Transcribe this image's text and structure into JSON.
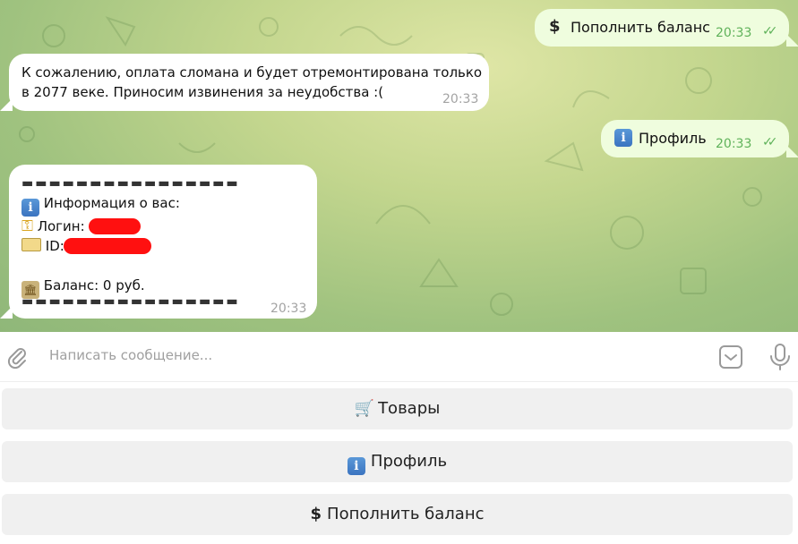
{
  "messages": {
    "topup_request": {
      "text": "Пополнить баланс",
      "time": "20:33"
    },
    "payment_error": {
      "line1": "К сожалению, оплата сломана и будет отремонтирована только",
      "line2": "в 2077 веке. Приносим извинения за неудобства :(",
      "time": "20:33"
    },
    "profile_request": {
      "text": "Профиль",
      "time": "20:33"
    },
    "profile_info": {
      "divider": "▬▬▬▬▬▬▬▬▬▬▬▬▬▬▬▬",
      "title": "Информация о вас:",
      "login_label": "Логин:",
      "id_label": "ID:",
      "balance": "Баланс: 0 руб.",
      "time": "20:33"
    }
  },
  "composer": {
    "placeholder": "Написать сообщение..."
  },
  "keyboard": {
    "products": "Товары",
    "profile": "Профиль",
    "topup": "Пополнить баланс"
  },
  "colors": {
    "outgoing_bubble": "#effdde",
    "incoming_bubble": "#ffffff",
    "redaction": "#ff1010",
    "check_green": "#5fb25a"
  },
  "icons": [
    "paperclip-icon",
    "sticker-icon",
    "microphone-icon",
    "cart-icon",
    "info-icon",
    "dollar-icon",
    "key-icon",
    "card-icon",
    "bank-icon",
    "double-check-icon"
  ]
}
